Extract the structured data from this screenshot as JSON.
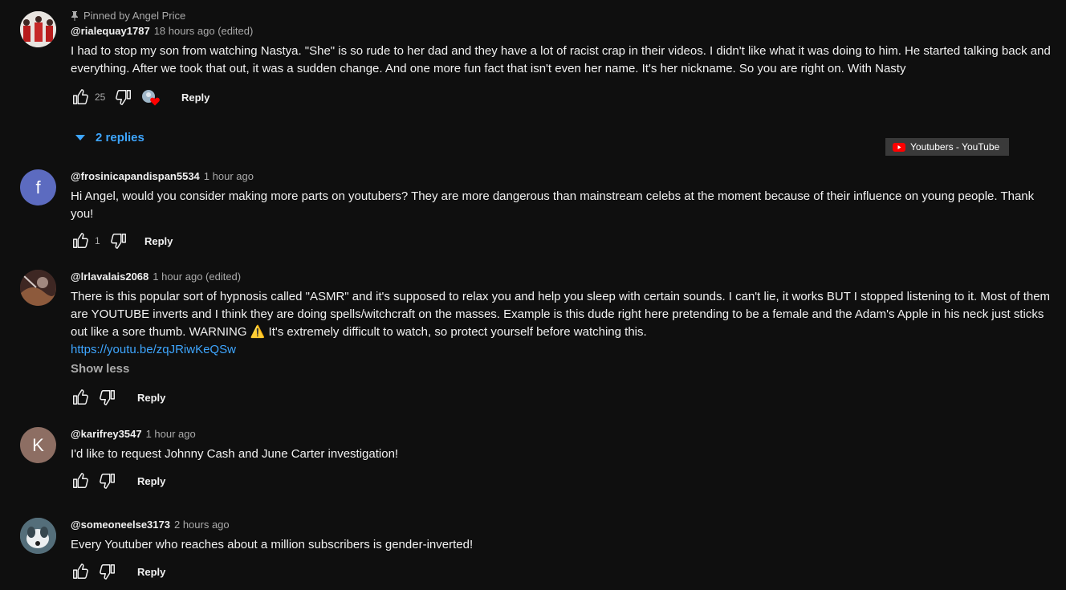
{
  "comments": [
    {
      "pinned": "Pinned by Angel Price",
      "author": "@rialequay1787",
      "time": "18 hours ago (edited)",
      "text": "I had to stop my son from watching Nastya. \"She\" is so rude to her dad and they have a lot of racist crap in their videos. I didn't like what it was doing to him. He started talking back and everything. After we took that out, it was a sudden change. And one more fun fact that isn't even her name. It's her nickname. So you are right on. With Nasty",
      "likes": "25",
      "reply_label": "Reply",
      "replies_label": "2 replies"
    },
    {
      "avatar_letter": "f",
      "avatar_color": "#5c6bc0",
      "author": "@frosinicapandispan5534",
      "time": "1 hour ago",
      "text": "Hi Angel, would you consider making more parts on youtubers? They are more dangerous than mainstream celebs at the moment because of their influence on young people. Thank you!",
      "likes": "1",
      "reply_label": "Reply"
    },
    {
      "author": "@lrlavalais2068",
      "time": "1 hour ago (edited)",
      "text": "There is this popular sort of hypnosis called \"ASMR\" and it's supposed to relax you and help you sleep with certain sounds. I can't lie, it works BUT I stopped listening to it. Most of them are YOUTUBE  inverts and I think they are doing spells/witchcraft on the masses. Example is this dude right here pretending to be a female and the Adam's Apple in his neck just sticks out like a sore thumb. WARNING ⚠️  It's extremely difficult to watch, so protect yourself before watching this.",
      "link": "https://youtu.be/zqJRiwKeQSw",
      "show_less": "Show less",
      "reply_label": "Reply"
    },
    {
      "avatar_letter": "K",
      "avatar_color": "#8d6e63",
      "author": "@karifrey3547",
      "time": "1 hour ago",
      "text": "I'd like to request Johnny Cash and June Carter investigation!",
      "reply_label": "Reply"
    },
    {
      "author": "@someoneelse3173",
      "time": "2 hours ago",
      "text": "Every Youtuber who reaches about a million subscribers is gender-inverted!",
      "reply_label": "Reply"
    }
  ],
  "tooltip": {
    "label": "Youtubers - YouTube"
  },
  "colors": {
    "background": "#0f0f0f",
    "link": "#3ea6ff",
    "heart": "#ff0000"
  }
}
